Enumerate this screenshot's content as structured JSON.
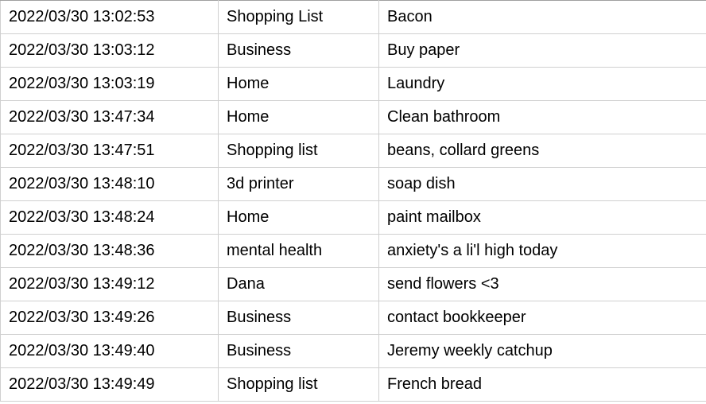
{
  "rows": [
    {
      "timestamp": "2022/03/30 13:02:53",
      "category": "Shopping List",
      "item": "Bacon"
    },
    {
      "timestamp": "2022/03/30 13:03:12",
      "category": "Business",
      "item": "Buy paper"
    },
    {
      "timestamp": "2022/03/30 13:03:19",
      "category": "Home",
      "item": "Laundry"
    },
    {
      "timestamp": "2022/03/30 13:47:34",
      "category": "Home",
      "item": "Clean bathroom"
    },
    {
      "timestamp": "2022/03/30 13:47:51",
      "category": "Shopping list",
      "item": "beans, collard greens"
    },
    {
      "timestamp": "2022/03/30 13:48:10",
      "category": "3d printer",
      "item": "soap dish"
    },
    {
      "timestamp": "2022/03/30 13:48:24",
      "category": "Home",
      "item": "paint mailbox"
    },
    {
      "timestamp": "2022/03/30 13:48:36",
      "category": "mental health",
      "item": "anxiety's a li'l high today"
    },
    {
      "timestamp": "2022/03/30 13:49:12",
      "category": "Dana",
      "item": "send flowers <3"
    },
    {
      "timestamp": "2022/03/30 13:49:26",
      "category": "Business",
      "item": "contact bookkeeper"
    },
    {
      "timestamp": "2022/03/30 13:49:40",
      "category": "Business",
      "item": "Jeremy weekly catchup"
    },
    {
      "timestamp": "2022/03/30 13:49:49",
      "category": "Shopping list",
      "item": "French bread"
    }
  ]
}
